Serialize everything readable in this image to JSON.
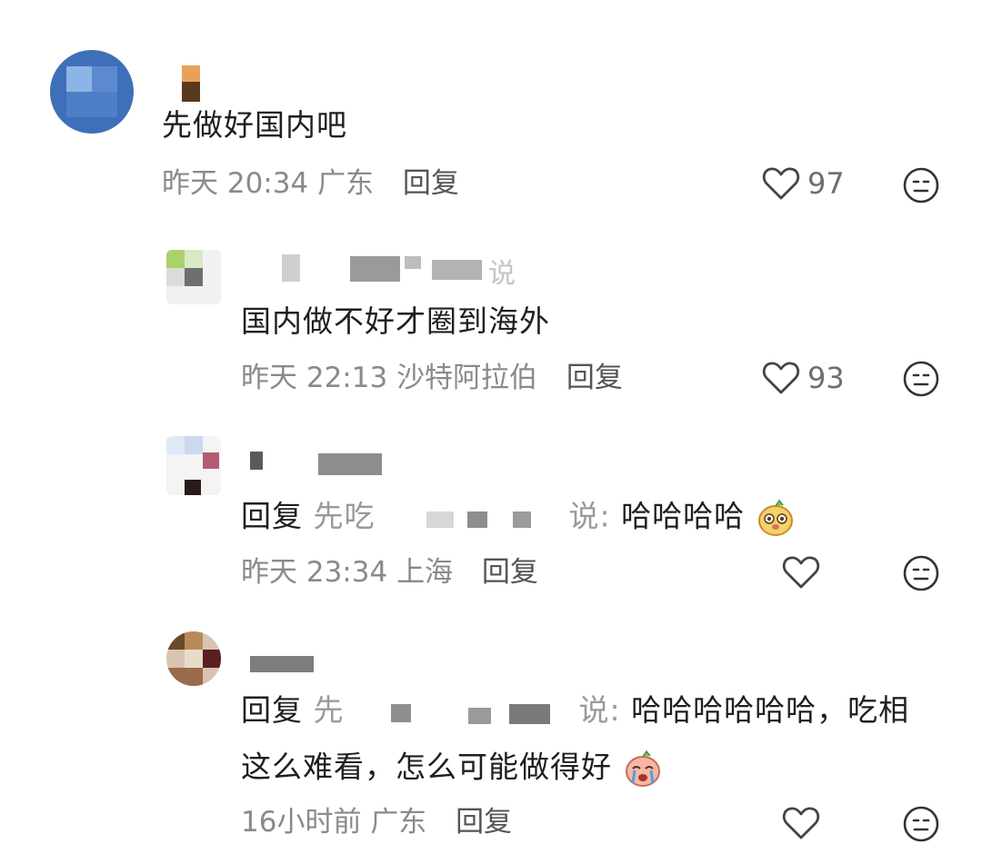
{
  "comments": [
    {
      "text": "先做好国内吧",
      "time": "昨天 20:34",
      "location": "广东",
      "reply": "回复",
      "likes": "97",
      "more_icon": "neutral-face-icon"
    },
    {
      "name_visible": "说",
      "text": "国内做不好才圈到海外",
      "time": "昨天 22:13",
      "location": "沙特阿拉伯",
      "reply": "回复",
      "likes": "93"
    },
    {
      "reply_prefix": "回复",
      "target_start": "先吃",
      "target_end": "说:",
      "text": "哈哈哈哈",
      "time": "昨天 23:34",
      "location": "上海",
      "reply": "回复",
      "likes": ""
    },
    {
      "reply_prefix": "回复",
      "target_start": "先",
      "target_end": "说:",
      "text_line1": "哈哈哈哈哈哈，吃相",
      "text_line2": "这么难看，怎么可能做得好",
      "time": "16小时前",
      "location": "广东",
      "reply": "回复",
      "likes": ""
    }
  ]
}
